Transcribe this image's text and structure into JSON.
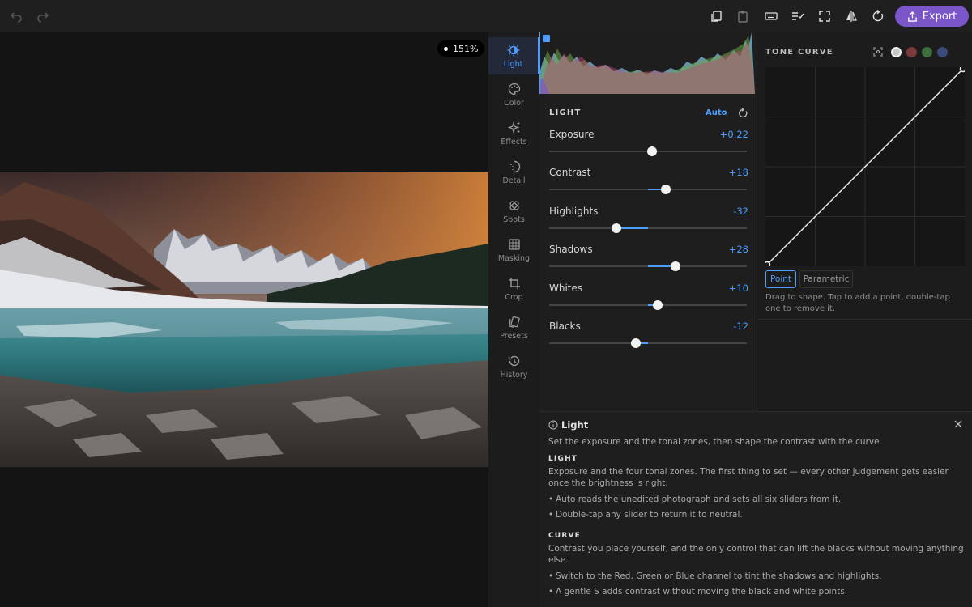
{
  "toolbar": {
    "undo_icon": "undo-icon",
    "redo_icon": "redo-icon",
    "right_icons": [
      "copy-icon",
      "paste-icon",
      "keyboard-icon",
      "checklist-icon",
      "fullscreen-icon",
      "compare-icon",
      "reset-icon"
    ],
    "export_label": "Export"
  },
  "canvas": {
    "zoom": "151%"
  },
  "rail": {
    "items": [
      {
        "label": "Light",
        "icon": "light-icon",
        "active": true
      },
      {
        "label": "Color",
        "icon": "palette-icon"
      },
      {
        "label": "Effects",
        "icon": "sparkle-icon"
      },
      {
        "label": "Detail",
        "icon": "detail-icon"
      },
      {
        "label": "Spots",
        "icon": "bandage-icon"
      },
      {
        "label": "Masking",
        "icon": "masking-icon"
      },
      {
        "label": "Crop",
        "icon": "crop-icon"
      },
      {
        "label": "Presets",
        "icon": "presets-icon"
      },
      {
        "label": "History",
        "icon": "history-icon"
      }
    ]
  },
  "light": {
    "title": "LIGHT",
    "auto_label": "Auto",
    "sliders": [
      {
        "label": "Exposure",
        "value": "+0.22",
        "pos": 0.522
      },
      {
        "label": "Contrast",
        "value": "+18",
        "pos": 0.59
      },
      {
        "label": "Highlights",
        "value": "-32",
        "pos": 0.34
      },
      {
        "label": "Shadows",
        "value": "+28",
        "pos": 0.64
      },
      {
        "label": "Whites",
        "value": "+10",
        "pos": 0.55
      },
      {
        "label": "Blacks",
        "value": "-12",
        "pos": 0.44
      }
    ]
  },
  "curve": {
    "title": "TONE CURVE",
    "channels": [
      {
        "name": "rgb",
        "color": "#c8c8c8"
      },
      {
        "name": "red",
        "color": "#7a3a3a"
      },
      {
        "name": "green",
        "color": "#3d6e3d"
      },
      {
        "name": "blue",
        "color": "#3a4a7a"
      }
    ],
    "mode_point": "Point",
    "mode_parametric": "Parametric",
    "hint": "Drag to shape. Tap to add a point, double-tap one to remove it."
  },
  "help": {
    "title": "Light",
    "intro": "Set the exposure and the tonal zones, then shape the contrast with the curve.",
    "light_heading": "LIGHT",
    "light_text": "Exposure and the four tonal zones. The first thing to set — every other judgement gets easier once the brightness is right.",
    "light_bullets": [
      "Auto reads the unedited photograph and sets all six sliders from it.",
      "Double-tap any slider to return it to neutral."
    ],
    "curve_heading": "CURVE",
    "curve_text": "Contrast you place yourself, and the only control that can lift the blacks without moving anything else.",
    "curve_bullets": [
      "Switch to the Red, Green or Blue channel to tint the shadows and highlights.",
      "A gentle S adds contrast without moving the black and white points."
    ]
  }
}
